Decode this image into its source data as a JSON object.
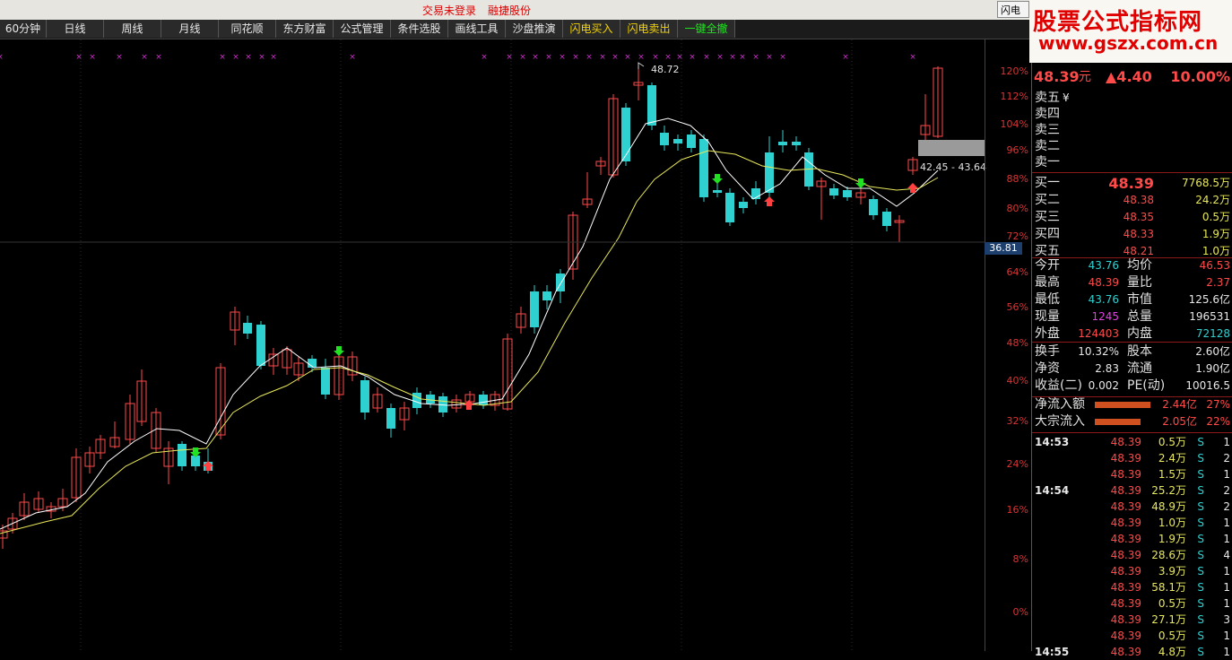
{
  "topbar": {
    "notice_trade": "交易未登录",
    "notice_stock": "融捷股份",
    "window_button": "闪电手"
  },
  "toolbar": {
    "items": [
      "60分钟",
      "日线",
      "周线",
      "月线",
      "同花顺",
      "东方财富",
      "公式管理",
      "条件选股",
      "画线工具",
      "沙盘推演",
      "闪电买入",
      "闪电卖出",
      "一键全撤"
    ]
  },
  "brand": {
    "line1": "股票公式指标网",
    "line2": "www.gszx.com.cn"
  },
  "axis": {
    "labels": [
      "120%",
      "112%",
      "104%",
      "96%",
      "88%",
      "80%",
      "72%",
      "64%",
      "56%",
      "48%",
      "40%",
      "32%",
      "24%",
      "16%",
      "8%",
      "0%"
    ],
    "current_price": "36.81"
  },
  "annotations": {
    "high": "48.72",
    "range": "42.45 - 43.64"
  },
  "quote": {
    "price": "48.39",
    "unit": "元",
    "change": "▲4.40",
    "pct": "10.00%"
  },
  "sell": [
    {
      "label": "卖五",
      "extra": "¥"
    },
    {
      "label": "卖四"
    },
    {
      "label": "卖三"
    },
    {
      "label": "卖二"
    },
    {
      "label": "卖一"
    }
  ],
  "buy": [
    {
      "label": "买一",
      "price": "48.39",
      "vol": "7768.5万"
    },
    {
      "label": "买二",
      "price": "48.38",
      "vol": "24.2万"
    },
    {
      "label": "买三",
      "price": "48.35",
      "vol": "0.5万"
    },
    {
      "label": "买四",
      "price": "48.33",
      "vol": "1.9万"
    },
    {
      "label": "买五",
      "price": "48.21",
      "vol": "1.0万"
    }
  ],
  "stats": [
    {
      "l1": "今开",
      "v1": "43.76",
      "c1": "green",
      "l2": "均价",
      "v2": "46.53",
      "c2": "red"
    },
    {
      "l1": "最高",
      "v1": "48.39",
      "c1": "red",
      "l2": "量比",
      "v2": "2.37",
      "c2": "red"
    },
    {
      "l1": "最低",
      "v1": "43.76",
      "c1": "green",
      "l2": "市值",
      "v2": "125.6亿",
      "c2": "wht"
    },
    {
      "l1": "现量",
      "v1": "1245",
      "c1": "mag",
      "l2": "总量",
      "v2": "196531",
      "c2": "wht"
    },
    {
      "l1": "外盘",
      "v1": "124403",
      "c1": "red",
      "l2": "内盘",
      "v2": "72128",
      "c2": "green"
    }
  ],
  "stats2": [
    {
      "l1": "换手",
      "v1": "10.32%",
      "l2": "股本",
      "v2": "2.60亿"
    },
    {
      "l1": "净资",
      "v1": "2.83",
      "l2": "流通",
      "v2": "1.90亿"
    },
    {
      "l1": "收益(二)",
      "v1": "0.002",
      "l2": "PE(动)",
      "v2": "10016.5"
    }
  ],
  "flows": [
    {
      "label": "净流入额",
      "value": "2.44亿",
      "pct": "27%",
      "fill": 0.27
    },
    {
      "label": "大宗流入",
      "value": "2.05亿",
      "pct": "22%",
      "fill": 0.22
    }
  ],
  "trades": [
    {
      "time": "14:53",
      "price": "48.39",
      "vol": "0.5万",
      "side": "S",
      "n": "1"
    },
    {
      "time": "",
      "price": "48.39",
      "vol": "2.4万",
      "side": "S",
      "n": "2"
    },
    {
      "time": "",
      "price": "48.39",
      "vol": "1.5万",
      "side": "S",
      "n": "1"
    },
    {
      "time": "14:54",
      "price": "48.39",
      "vol": "25.2万",
      "side": "S",
      "n": "2"
    },
    {
      "time": "",
      "price": "48.39",
      "vol": "48.9万",
      "side": "S",
      "n": "2"
    },
    {
      "time": "",
      "price": "48.39",
      "vol": "1.0万",
      "side": "S",
      "n": "1"
    },
    {
      "time": "",
      "price": "48.39",
      "vol": "1.9万",
      "side": "S",
      "n": "1"
    },
    {
      "time": "",
      "price": "48.39",
      "vol": "28.6万",
      "side": "S",
      "n": "4"
    },
    {
      "time": "",
      "price": "48.39",
      "vol": "3.9万",
      "side": "S",
      "n": "1"
    },
    {
      "time": "",
      "price": "48.39",
      "vol": "58.1万",
      "side": "S",
      "n": "1"
    },
    {
      "time": "",
      "price": "48.39",
      "vol": "0.5万",
      "side": "S",
      "n": "1"
    },
    {
      "time": "",
      "price": "48.39",
      "vol": "27.1万",
      "side": "S",
      "n": "3"
    },
    {
      "time": "",
      "price": "48.39",
      "vol": "0.5万",
      "side": "S",
      "n": "1"
    },
    {
      "time": "14:55",
      "price": "48.39",
      "vol": "4.8万",
      "side": "S",
      "n": "1"
    }
  ],
  "colors": {
    "up": "#ff4a4a",
    "down": "#2fd0d0",
    "ma_fast": "#ffffff",
    "ma_slow": "#e8e85a",
    "signal_buy": "#22e022",
    "signal_sell": "#ff4040",
    "marker": "#d030d0"
  }
}
